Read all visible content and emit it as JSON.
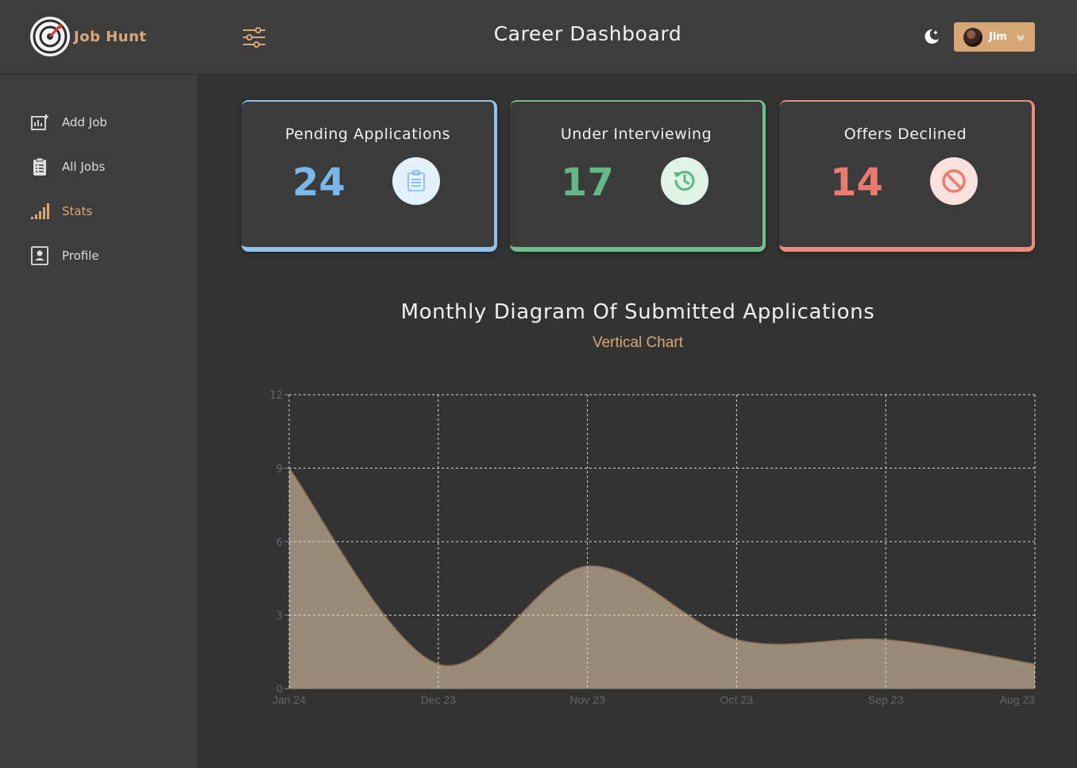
{
  "app": {
    "name": "Job Hunt"
  },
  "header": {
    "title": "Career Dashboard",
    "user_name": "Jim"
  },
  "sidebar": {
    "items": [
      {
        "label": "Add Job",
        "icon": "add-chart-icon",
        "active": false
      },
      {
        "label": "All Jobs",
        "icon": "clipboard-list-icon",
        "active": false
      },
      {
        "label": "Stats",
        "icon": "signal-bars-icon",
        "active": true
      },
      {
        "label": "Profile",
        "icon": "profile-card-icon",
        "active": false
      }
    ]
  },
  "stats": [
    {
      "title": "Pending Applications",
      "count": "24",
      "icon": "clipboard-icon",
      "color": "#7ab7ea"
    },
    {
      "title": "Under Interviewing",
      "count": "17",
      "icon": "history-icon",
      "color": "#62b886"
    },
    {
      "title": "Offers Declined",
      "count": "14",
      "icon": "ban-icon",
      "color": "#ea7b6f"
    }
  ],
  "chart": {
    "title": "Monthly Diagram Of Submitted Applications",
    "subtitle": "Vertical Chart"
  },
  "chart_data": {
    "type": "area",
    "categories": [
      "Jan 24",
      "Dec 23",
      "Nov 23",
      "Oct 23",
      "Sep 23",
      "Aug 23"
    ],
    "values": [
      9,
      1,
      5,
      2,
      2,
      1
    ],
    "ylim": [
      0,
      12
    ],
    "yticks": [
      0,
      3,
      6,
      9,
      12
    ],
    "grid": true,
    "fill_color": "#9a8a78",
    "stroke_color": "#8a6a4a"
  },
  "colors": {
    "accent": "#d9a874"
  }
}
